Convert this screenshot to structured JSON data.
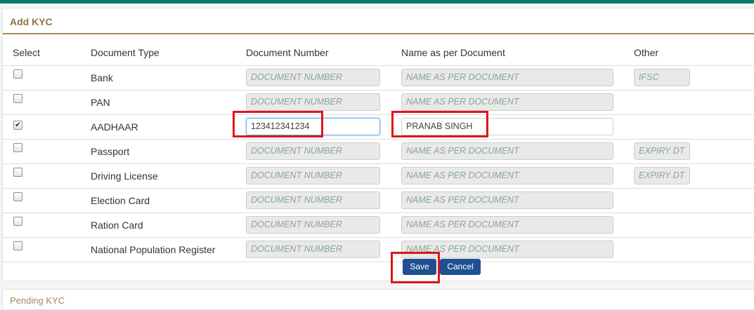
{
  "panel": {
    "title": "Add KYC"
  },
  "table": {
    "headers": [
      "Select",
      "Document Type",
      "Document Number",
      "Name as per Document",
      "Other"
    ],
    "rows": [
      {
        "checked": false,
        "doc_type": "Bank",
        "doc_number": "",
        "doc_number_placeholder": "DOCUMENT NUMBER",
        "name": "",
        "name_placeholder": "NAME AS PER DOCUMENT",
        "other_placeholder": "IFSC"
      },
      {
        "checked": false,
        "doc_type": "PAN",
        "doc_number": "",
        "doc_number_placeholder": "DOCUMENT NUMBER",
        "name": "",
        "name_placeholder": "NAME AS PER DOCUMENT",
        "other_placeholder": ""
      },
      {
        "checked": true,
        "doc_type": "AADHAAR",
        "doc_number": "123412341234",
        "doc_number_placeholder": "DOCUMENT NUMBER",
        "name": "PRANAB SINGH",
        "name_placeholder": "NAME AS PER DOCUMENT",
        "other_placeholder": ""
      },
      {
        "checked": false,
        "doc_type": "Passport",
        "doc_number": "",
        "doc_number_placeholder": "DOCUMENT NUMBER",
        "name": "",
        "name_placeholder": "NAME AS PER DOCUMENT",
        "other_placeholder": "EXPIRY DT"
      },
      {
        "checked": false,
        "doc_type": "Driving License",
        "doc_number": "",
        "doc_number_placeholder": "DOCUMENT NUMBER",
        "name": "",
        "name_placeholder": "NAME AS PER DOCUMENT",
        "other_placeholder": "EXPIRY DT"
      },
      {
        "checked": false,
        "doc_type": "Election Card",
        "doc_number": "",
        "doc_number_placeholder": "DOCUMENT NUMBER",
        "name": "",
        "name_placeholder": "NAME AS PER DOCUMENT",
        "other_placeholder": ""
      },
      {
        "checked": false,
        "doc_type": "Ration Card",
        "doc_number": "",
        "doc_number_placeholder": "DOCUMENT NUMBER",
        "name": "",
        "name_placeholder": "NAME AS PER DOCUMENT",
        "other_placeholder": ""
      },
      {
        "checked": false,
        "doc_type": "National Population Register",
        "doc_number": "",
        "doc_number_placeholder": "DOCUMENT NUMBER",
        "name": "",
        "name_placeholder": "NAME AS PER DOCUMENT",
        "other_placeholder": ""
      }
    ]
  },
  "actions": {
    "save_label": "Save",
    "cancel_label": "Cancel"
  },
  "pending": {
    "title": "Pending KYC"
  },
  "colors": {
    "accent": "#0b7a6e",
    "heading": "#8e7442",
    "button": "#1f5191",
    "highlight": "#e0141b"
  }
}
